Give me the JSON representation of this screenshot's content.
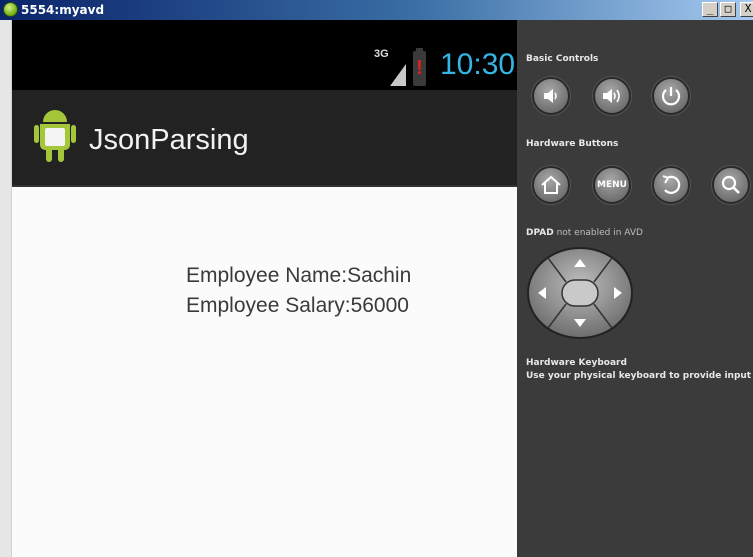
{
  "window": {
    "title": "5554:myavd",
    "controls": {
      "minimize": "_",
      "maximize": "□",
      "close": "X"
    }
  },
  "status_bar": {
    "network": "3G",
    "time": "10:30",
    "time_color": "#33b5e5",
    "battery_alert": "!"
  },
  "action_bar": {
    "title": "JsonParsing",
    "logo_icon": "android-app-icon"
  },
  "content": {
    "line1": "Employee Name:Sachin",
    "line2": "Employee Salary:56000"
  },
  "panel": {
    "basic_controls_label": "Basic Controls",
    "basic_controls": [
      {
        "name": "volume-down-icon"
      },
      {
        "name": "volume-up-icon"
      },
      {
        "name": "power-icon"
      }
    ],
    "hardware_buttons_label": "Hardware Buttons",
    "hardware_buttons": [
      {
        "name": "home-icon"
      },
      {
        "name": "menu-button",
        "label": "MENU"
      },
      {
        "name": "back-icon"
      },
      {
        "name": "search-icon"
      }
    ],
    "dpad_label_bold": "DPAD",
    "dpad_label_rest": "not enabled in AVD",
    "keyboard_label": "Hardware Keyboard",
    "keyboard_desc": "Use your physical keyboard to provide input"
  }
}
